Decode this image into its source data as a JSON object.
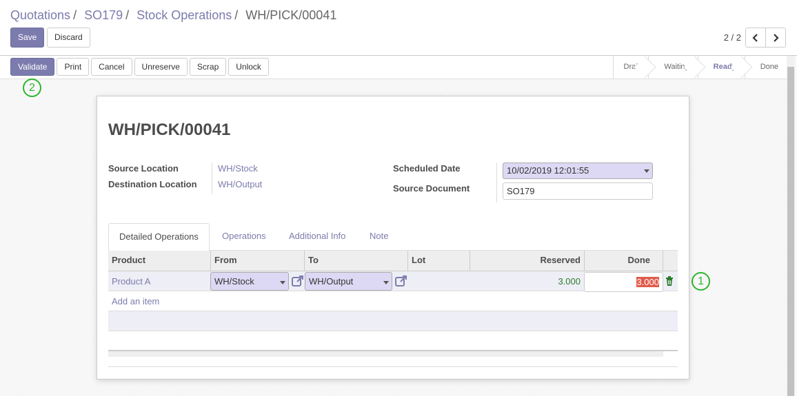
{
  "breadcrumb": {
    "items": [
      "Quotations",
      "SO179",
      "Stock Operations"
    ],
    "separator": "/",
    "current": "WH/PICK/00041"
  },
  "toolbar": {
    "save_label": "Save",
    "discard_label": "Discard"
  },
  "pager": {
    "value": "2 / 2"
  },
  "actions": {
    "validate": "Validate",
    "print": "Print",
    "cancel": "Cancel",
    "unreserve": "Unreserve",
    "scrap": "Scrap",
    "unlock": "Unlock"
  },
  "stages": {
    "items": [
      "Draft",
      "Waiting",
      "Ready",
      "Done"
    ],
    "active": "Ready"
  },
  "markers": {
    "one": "1",
    "two": "2"
  },
  "form": {
    "title": "WH/PICK/00041",
    "source_location_label": "Source Location",
    "source_location": "WH/Stock",
    "destination_location_label": "Destination Location",
    "destination_location": "WH/Output",
    "scheduled_date_label": "Scheduled Date",
    "scheduled_date": "10/02/2019 12:01:55",
    "source_document_label": "Source Document",
    "source_document": "SO179"
  },
  "tabs": [
    "Detailed Operations",
    "Operations",
    "Additional Info",
    "Note"
  ],
  "table": {
    "headers": {
      "product": "Product",
      "from": "From",
      "to": "To",
      "lot": "Lot",
      "reserved": "Reserved",
      "done": "Done"
    },
    "rows": [
      {
        "product": "Product A",
        "from": "WH/Stock",
        "to": "WH/Output",
        "lot": "",
        "reserved": "3.000",
        "done": "3.000"
      }
    ],
    "add_item": "Add an item"
  },
  "colors": {
    "accent": "#7c7bad",
    "marker": "#2db52d",
    "reserved": "#2c7b2c",
    "selection": "#e05b4b"
  }
}
